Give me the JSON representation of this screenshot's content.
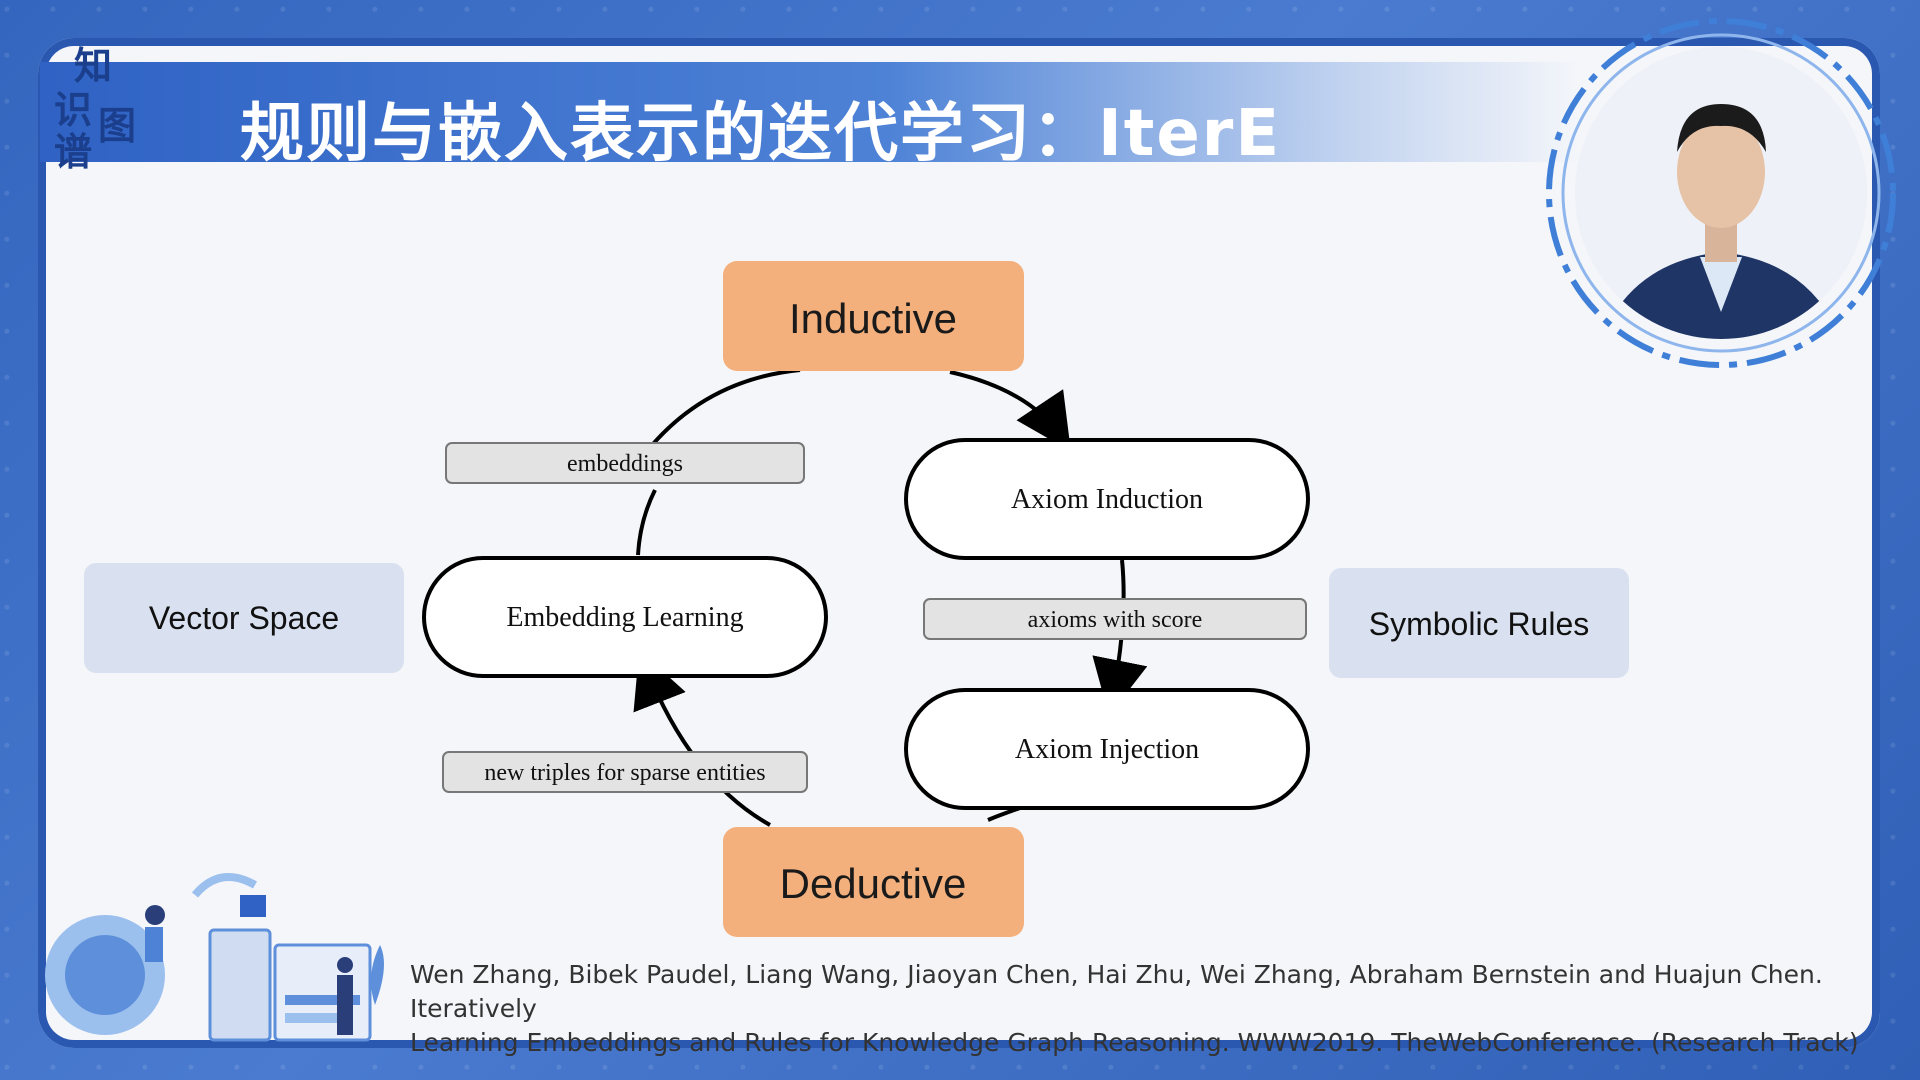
{
  "title": "规则与嵌入表示的迭代学习：IterE",
  "logo": {
    "line1": "知",
    "line2": "识",
    "line3": "谱",
    "line4": "图"
  },
  "diagram": {
    "inductive": "Inductive",
    "deductive": "Deductive",
    "vector_space": "Vector Space",
    "symbolic_rules": "Symbolic Rules",
    "embedding_learning": "Embedding Learning",
    "axiom_induction": "Axiom Induction",
    "axiom_injection": "Axiom Injection",
    "embeddings_label": "embeddings",
    "axioms_label": "axioms with score",
    "triples_label": "new triples for sparse entities"
  },
  "citation": {
    "line1": "Wen Zhang, Bibek Paudel, Liang Wang, Jiaoyan Chen, Hai Zhu, Wei Zhang, Abraham Bernstein and Huajun Chen. Iteratively",
    "line2": "Learning Embeddings and Rules for Knowledge Graph Reasoning. WWW2019. TheWebConference. (Research Track)"
  },
  "colors": {
    "accent": "#f4b07c",
    "box": "#d9e1f0",
    "pill": "#e3e3e3",
    "band": "#2f62c4"
  }
}
